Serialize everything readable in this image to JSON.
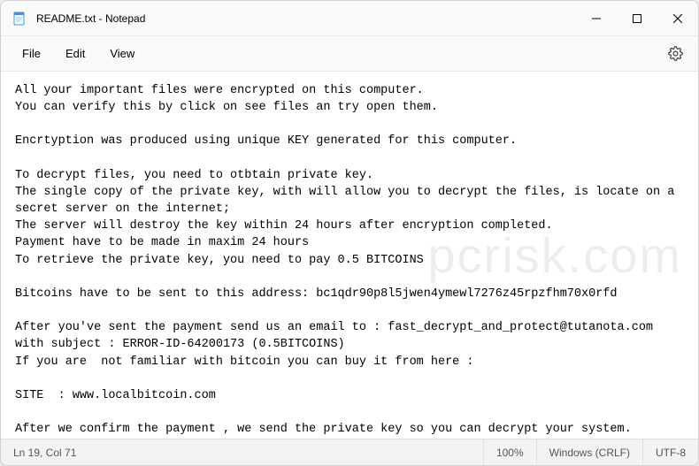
{
  "window": {
    "title": "README.txt - Notepad"
  },
  "menu": {
    "file": "File",
    "edit": "Edit",
    "view": "View"
  },
  "content": {
    "body": "All your important files were encrypted on this computer.\nYou can verify this by click on see files an try open them.\n\nEncrtyption was produced using unique KEY generated for this computer.\n\nTo decrypt files, you need to otbtain private key.\nThe single copy of the private key, with will allow you to decrypt the files, is locate on a secret server on the internet;\nThe server will destroy the key within 24 hours after encryption completed.\nPayment have to be made in maxim 24 hours\nTo retrieve the private key, you need to pay 0.5 BITCOINS\n\nBitcoins have to be sent to this address: bc1qdr90p8l5jwen4ymewl7276z45rpzfhm70x0rfd\n\nAfter you've sent the payment send us an email to : fast_decrypt_and_protect@tutanota.com with subject : ERROR-ID-64200173 (0.5BITCOINS)\nIf you are  not familiar with bitcoin you can buy it from here :\n\nSITE  : www.localbitcoin.com\n\nAfter we confirm the payment , we send the private key so you can decrypt your system."
  },
  "status": {
    "position": "Ln 19, Col 71",
    "zoom": "100%",
    "line_ending": "Windows (CRLF)",
    "encoding": "UTF-8"
  },
  "watermark": "pcrisk.com"
}
